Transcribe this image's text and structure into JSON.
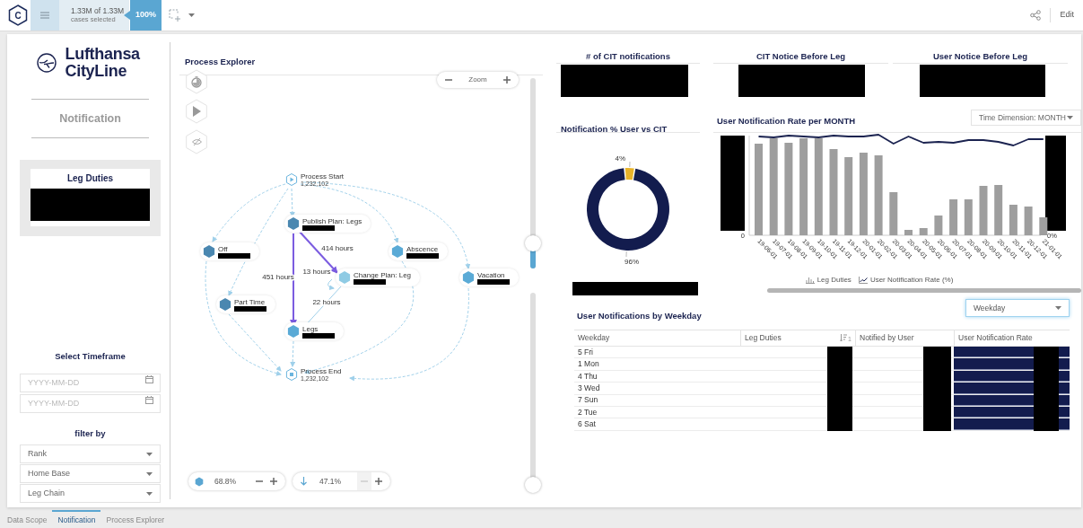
{
  "top_bar": {
    "logo_letter": "C",
    "selection_count": "1.33M of 1.33M",
    "selection_label": "cases selected",
    "selection_percent": "100%",
    "edit_label": "Edit"
  },
  "brand_name": "Lufthansa CityLine",
  "page_heading": "Notification",
  "leg_duties_card": {
    "title": "Leg Duties"
  },
  "timeframe": {
    "title": "Select Timeframe",
    "fields": [
      {
        "placeholder": "YYYY-MM-DD"
      },
      {
        "placeholder": "YYYY-MM-DD"
      }
    ]
  },
  "filters": {
    "title": "filter by",
    "dropdowns": [
      "Rank",
      "Home Base",
      "Leg Chain"
    ]
  },
  "process_explorer": {
    "title": "Process Explorer",
    "zoom_label": "Zoom",
    "nodes": [
      {
        "label": "Process Start",
        "count": "1,232,102",
        "kind": "start"
      },
      {
        "label": "Publish Plan: Legs",
        "kind": "activity",
        "color": "#4a87b0"
      },
      {
        "label": "Off",
        "kind": "activity",
        "color": "#4a87b0"
      },
      {
        "label": "Abscence",
        "kind": "activity",
        "color": "#5aaad6"
      },
      {
        "label": "Change Plan: Leg",
        "kind": "activity",
        "color": "#8fcbe4"
      },
      {
        "label": "Vacation",
        "kind": "activity",
        "color": "#5aaad6"
      },
      {
        "label": "Part Time",
        "kind": "activity",
        "color": "#4a87b0"
      },
      {
        "label": "Legs",
        "kind": "activity",
        "color": "#5aaad6"
      },
      {
        "label": "Process End",
        "count": "1,232,102",
        "kind": "end"
      }
    ],
    "edges": [
      {
        "label": "414 hours",
        "kind": "strong"
      },
      {
        "label": "451 hours",
        "kind": "strong"
      },
      {
        "label": "13 hours",
        "kind": "loop"
      },
      {
        "label": "22 hours",
        "kind": "light"
      }
    ],
    "sliders": [
      {
        "level": 0.13
      },
      {
        "level": 0
      }
    ],
    "activity_control": {
      "reading": "68.8%",
      "minus_disabled": false
    },
    "path_control": {
      "reading": "47.1%",
      "minus_disabled": true
    }
  },
  "kpis": [
    {
      "title": "# of CIT notifications"
    },
    {
      "title": "CIT Notice Before Leg"
    },
    {
      "title": "User Notice Before Leg"
    }
  ],
  "donut_panel": {
    "title": "Notification % User vs CIT",
    "chart_data": {
      "type": "donut",
      "values": [
        4,
        96
      ],
      "value_labels": [
        "4%",
        "96%"
      ],
      "colors": [
        "#e8b32a",
        "#131c4e"
      ]
    }
  },
  "rate_chart": {
    "title": "User Notification Rate per MONTH",
    "time_dimension": "Time Dimension: MONTH",
    "left_axis_label": "0",
    "right_axis_label": "0%",
    "x_labels": [
      "19-06-01",
      "19-07-01",
      "19-08-01",
      "19-09-01",
      "19-10-01",
      "19-11-01",
      "19-12-01",
      "20-01-01",
      "20-02-01",
      "20-03-01",
      "20-04-01",
      "20-05-01",
      "20-06-01",
      "20-07-01",
      "20-08-01",
      "20-09-01",
      "20-10-01",
      "20-11-01",
      "20-12-01",
      "21-01-01"
    ],
    "legend": [
      {
        "label": "Leg Duties",
        "kind": "bar"
      },
      {
        "label": "User Notification Rate (%)",
        "kind": "line"
      }
    ]
  },
  "weekday_table": {
    "title": "User Notifications by Weekday",
    "grouping": "Weekday",
    "columns": [
      {
        "label": "Weekday"
      },
      {
        "label": "Leg Duties",
        "sort_rank": "1"
      },
      {
        "label": "Notified by User"
      },
      {
        "label": "User Notification Rate"
      }
    ],
    "rows": [
      "5 Fri",
      "1 Mon",
      "4 Thu",
      "3 Wed",
      "7 Sun",
      "2 Tue",
      "6 Sat"
    ]
  },
  "bottom_tabs": [
    {
      "label": "Data Scope",
      "selected": false
    },
    {
      "label": "Notification",
      "selected": true
    },
    {
      "label": "Process Explorer",
      "selected": false
    }
  ]
}
